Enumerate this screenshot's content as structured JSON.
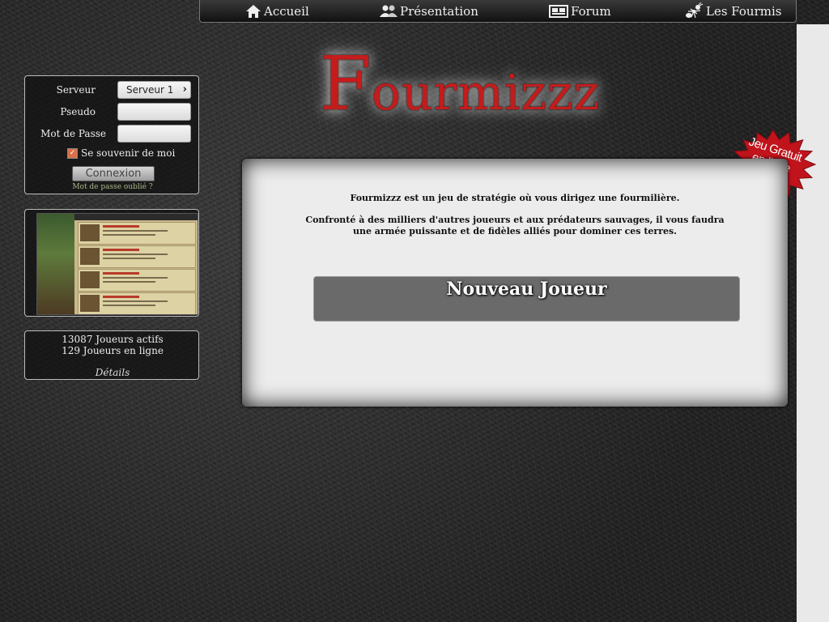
{
  "nav": {
    "items": [
      {
        "label": "Accueil",
        "icon": "house-icon"
      },
      {
        "label": "Présentation",
        "icon": "users-icon"
      },
      {
        "label": "Forum",
        "icon": "forum-icon"
      },
      {
        "label": "Les Fourmis",
        "icon": "ant-icon"
      }
    ]
  },
  "logo": {
    "first_letter": "F",
    "rest": "ourmizzz"
  },
  "badge": {
    "line1": "Jeu Gratuit",
    "line2": "en ligne",
    "color": "#c0131b"
  },
  "login": {
    "server_label": "Serveur",
    "server_value": "Serveur 1",
    "pseudo_label": "Pseudo",
    "password_label": "Mot de Passe",
    "remember_label": "Se souvenir de moi",
    "remember_checked": true,
    "submit_label": "Connexion",
    "forgot_label": "Mot de passe oublié ?"
  },
  "stats": {
    "active_players": "13087 Joueurs actifs",
    "online_players": "129 Joueurs en ligne",
    "details_label": "Détails"
  },
  "main": {
    "intro_line1": "Fourmizzz est un jeu de stratégie où vous dirigez une fourmilière.",
    "intro_line2": "Confronté à des milliers d'autres joueurs et aux prédateurs sauvages, il vous faudra",
    "intro_line3": "une armée puissante et de fidèles alliés pour dominer ces terres.",
    "new_player_label": "Nouveau Joueur"
  },
  "colors": {
    "logo_red": "#c41c1c",
    "link_green": "#a9b98a",
    "button_gray": "#6a6a6a"
  }
}
